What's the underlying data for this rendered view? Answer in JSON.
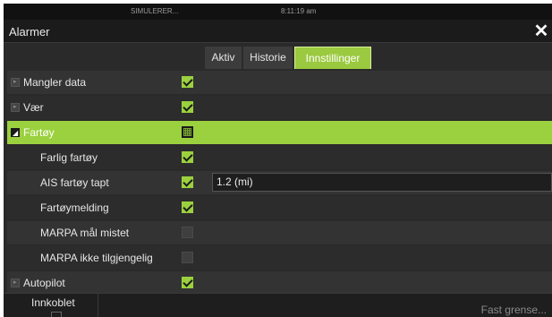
{
  "status_bar": {
    "left_text": "SIMULERER...",
    "time": "8:11:19 am"
  },
  "window": {
    "title": "Alarmer",
    "close_glyph": "✕"
  },
  "tabs": [
    {
      "label": "Aktiv",
      "active": false
    },
    {
      "label": "Historie",
      "active": false
    },
    {
      "label": "Innstillinger",
      "active": true
    }
  ],
  "rows": [
    {
      "label": "Mangler data",
      "level": "top",
      "expander": "collapsed",
      "checkbox": "checked"
    },
    {
      "label": "Vær",
      "level": "top",
      "expander": "collapsed",
      "checkbox": "checked"
    },
    {
      "label": "Fartøy",
      "level": "top",
      "expander": "expanded",
      "checkbox": "partial",
      "selected": true
    },
    {
      "label": "Farlig fartøy",
      "level": "child",
      "checkbox": "checked"
    },
    {
      "label": "AIS fartøy tapt",
      "level": "child",
      "checkbox": "checked",
      "value": "1.2 (mi)"
    },
    {
      "label": "Fartøymelding",
      "level": "child",
      "checkbox": "checked"
    },
    {
      "label": "MARPA mål mistet",
      "level": "child",
      "checkbox": "unchecked"
    },
    {
      "label": "MARPA ikke tilgjengelig",
      "level": "child",
      "checkbox": "unchecked"
    },
    {
      "label": "Autopilot",
      "level": "top",
      "expander": "collapsed",
      "checkbox": "checked"
    }
  ],
  "bottom_bar": {
    "enabled_label": "Innkoblet",
    "fixed_limit_label": "Fast grense..."
  },
  "colors": {
    "accent": "#9bd13e",
    "background": "#2a2a2a",
    "row_even": "#333333",
    "row_odd": "#2c2c2c"
  }
}
